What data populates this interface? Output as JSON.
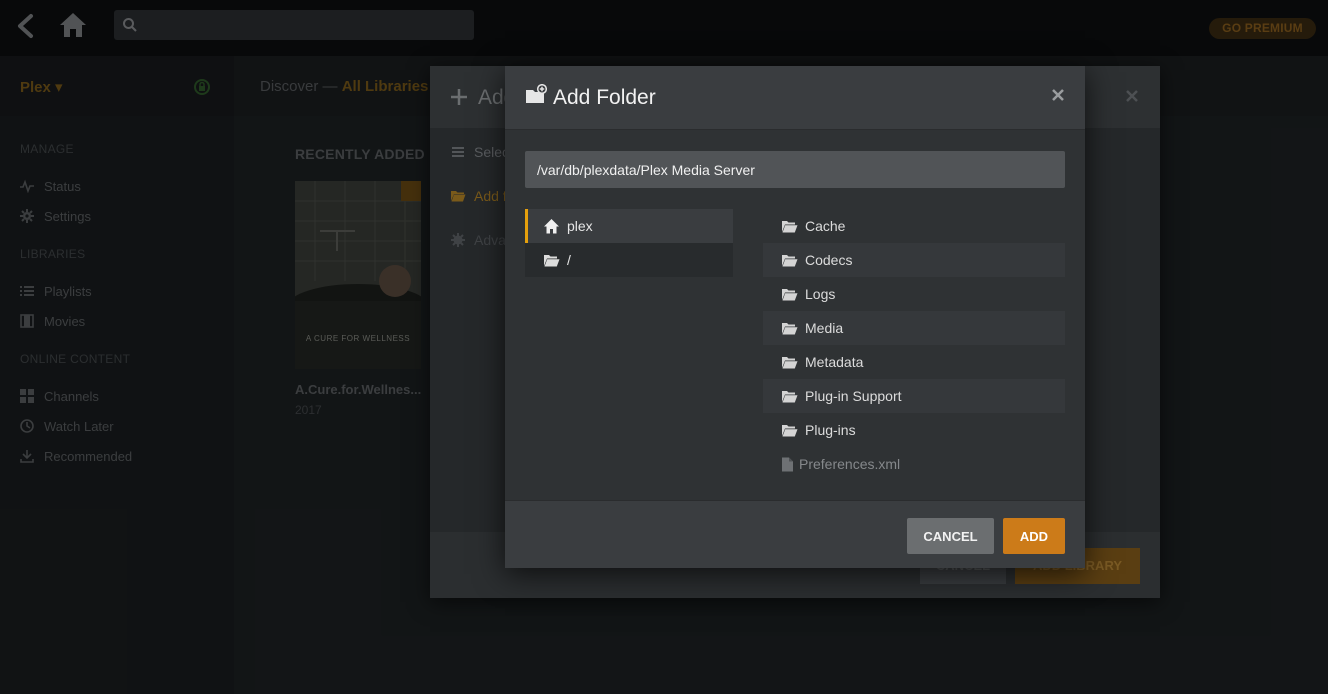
{
  "topbar": {
    "search_placeholder": "",
    "premium_label": "GO PREMIUM"
  },
  "sidebar": {
    "server_name": "Plex ▾",
    "sections": [
      {
        "label": "MANAGE",
        "items": [
          {
            "label": "Status",
            "icon": "pulse-icon"
          },
          {
            "label": "Settings",
            "icon": "gear-icon"
          }
        ]
      },
      {
        "label": "LIBRARIES",
        "items": [
          {
            "label": "Playlists",
            "icon": "list-icon"
          },
          {
            "label": "Movies",
            "icon": "film-icon"
          }
        ]
      },
      {
        "label": "ONLINE CONTENT",
        "items": [
          {
            "label": "Channels",
            "icon": "grid-icon"
          },
          {
            "label": "Watch Later",
            "icon": "clock-icon"
          },
          {
            "label": "Recommended",
            "icon": "download-icon"
          }
        ]
      }
    ]
  },
  "main": {
    "breadcrumb_prefix": "Discover — ",
    "breadcrumb_accent": "All Libraries",
    "recent_title": "RECENTLY ADDED",
    "poster": {
      "caption": "A CURE FOR WELLNESS",
      "title": "A.Cure.for.Wellnes...",
      "year": "2017"
    }
  },
  "bg_dialog": {
    "title": "Add",
    "steps": [
      "Selec",
      "Add f",
      "Adva"
    ],
    "cancel_label": "CANCEL",
    "add_label": "ADD LIBRARY"
  },
  "dialog": {
    "title": "Add Folder",
    "path_value": "/var/db/plexdata/Plex Media Server",
    "left_items": [
      {
        "label": "plex",
        "icon": "home-icon",
        "selected": true
      },
      {
        "label": "/",
        "icon": "folder-open-icon",
        "selected": false
      }
    ],
    "right_items": [
      {
        "label": "Cache",
        "type": "folder"
      },
      {
        "label": "Codecs",
        "type": "folder"
      },
      {
        "label": "Logs",
        "type": "folder"
      },
      {
        "label": "Media",
        "type": "folder"
      },
      {
        "label": "Metadata",
        "type": "folder"
      },
      {
        "label": "Plug-in Support",
        "type": "folder"
      },
      {
        "label": "Plug-ins",
        "type": "folder"
      },
      {
        "label": "Preferences.xml",
        "type": "file"
      }
    ],
    "cancel_label": "CANCEL",
    "add_label": "ADD"
  },
  "colors": {
    "accent": "#e5a00d",
    "add_button": "#cc7b19"
  }
}
